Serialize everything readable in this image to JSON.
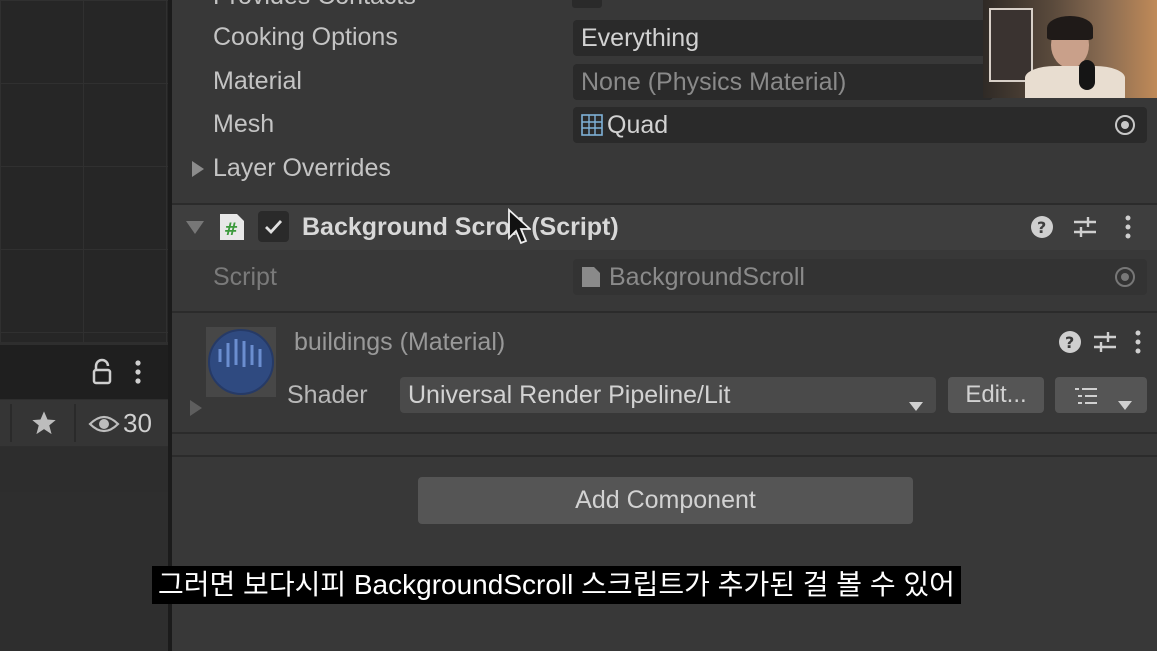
{
  "left": {
    "visible_count": "30"
  },
  "inspector": {
    "cut_off_label": "Provides Contacts",
    "cooking_options": {
      "label": "Cooking Options",
      "value": "Everything"
    },
    "material": {
      "label": "Material",
      "value": "None (Physics Material)"
    },
    "mesh": {
      "label": "Mesh",
      "value": "Quad"
    },
    "layer_overrides": {
      "label": "Layer Overrides"
    },
    "background_scroll": {
      "title": "Background Scroll (Script)",
      "script_label": "Script",
      "script_value": "BackgroundScroll"
    },
    "material_component": {
      "title": "buildings (Material)",
      "shader_label": "Shader",
      "shader_value": "Universal Render Pipeline/Lit",
      "edit_label": "Edit..."
    },
    "add_component_label": "Add Component"
  },
  "subtitle": "그러면 보다시피 BackgroundScroll 스크립트가 추가된 걸 볼 수 있어"
}
